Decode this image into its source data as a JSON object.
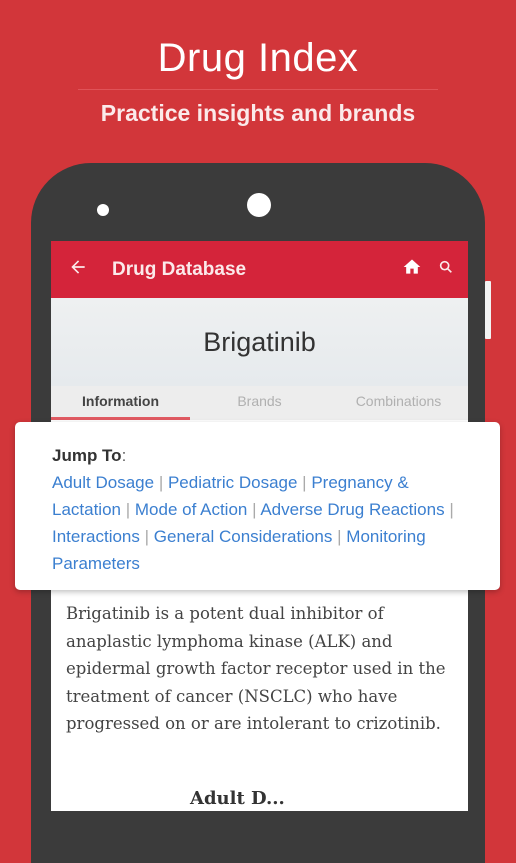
{
  "promo": {
    "title": "Drug Index",
    "subtitle": "Practice insights and brands"
  },
  "appbar": {
    "back_icon": "arrow-left-icon",
    "title": "Drug Database",
    "home_icon": "home-icon",
    "search_icon": "search-icon"
  },
  "drug": {
    "name": "Brigatinib"
  },
  "tabs": [
    {
      "label": "Information",
      "active": true
    },
    {
      "label": "Brands",
      "active": false
    },
    {
      "label": "Combinations",
      "active": false
    }
  ],
  "jump_to": {
    "label": "Jump To",
    "colon": ":",
    "separator": "|",
    "links": [
      "Adult Dosage",
      "Pediatric Dosage",
      "Pregnancy & Lactation",
      "Mode of Action",
      "Adverse Drug Reactions",
      "Interactions",
      "General Considerations",
      "Monitoring Parameters"
    ]
  },
  "description": " Brigatinib is a potent dual inhibitor of anaplastic lymphoma kinase (ALK) and epidermal growth factor receptor used in the treatment of cancer (NSCLC) who have progressed on or are intolerant to crizotinib.",
  "next_section_heading": "Adult D...",
  "colors": {
    "background": "#d2363a",
    "appbar": "#d4243a",
    "link": "#3b7fd0",
    "phone": "#3b3b3b"
  }
}
